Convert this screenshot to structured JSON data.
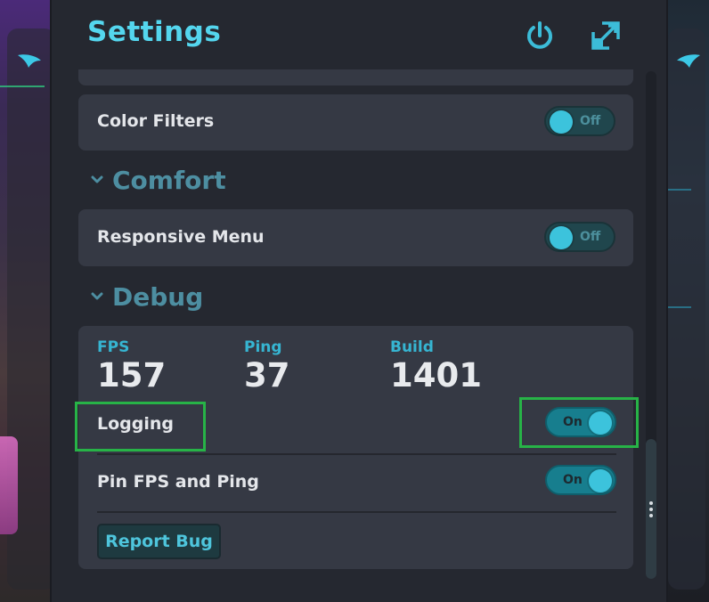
{
  "header": {
    "title": "Settings",
    "power_icon": "power-icon",
    "maximize_icon": "maximize-icon"
  },
  "settings": {
    "color_filters": {
      "label": "Color Filters",
      "state": "Off"
    },
    "comfort": {
      "title": "Comfort",
      "responsive_menu": {
        "label": "Responsive Menu",
        "state": "Off"
      }
    },
    "debug": {
      "title": "Debug",
      "stats": [
        {
          "label": "FPS",
          "value": "157"
        },
        {
          "label": "Ping",
          "value": "37"
        },
        {
          "label": "Build",
          "value": "1401"
        }
      ],
      "logging": {
        "label": "Logging",
        "state": "On"
      },
      "pin_fps_ping": {
        "label": "Pin FPS and Ping",
        "state": "On"
      },
      "report_bug_label": "Report Bug"
    }
  },
  "colors": {
    "accent": "#54d6ee",
    "section": "#4d8ea1",
    "highlight": "#27b347",
    "panel": "#252830",
    "card": "#353944"
  },
  "scroll_position": 0.72
}
